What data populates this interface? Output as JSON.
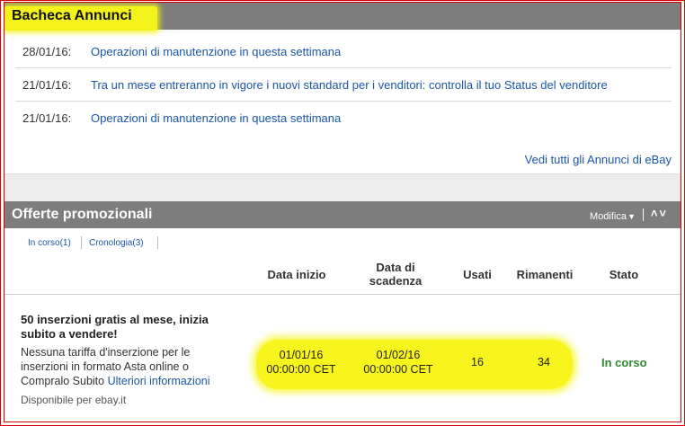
{
  "announcements": {
    "title": "Bacheca Annunci",
    "items": [
      {
        "date": "28/01/16:",
        "text": "Operazioni di manutenzione in questa settimana"
      },
      {
        "date": "21/01/16:",
        "text": "Tra un mese entreranno in vigore i nuovi standard per i venditori: controlla il tuo Status del venditore"
      },
      {
        "date": "21/01/16:",
        "text": "Operazioni di manutenzione in questa settimana"
      }
    ],
    "see_all": "Vedi tutti gli Annunci di eBay"
  },
  "promotions": {
    "title": "Offerte promozionali",
    "modify_label": "Modifica",
    "tabs": [
      {
        "label": "In corso(1)"
      },
      {
        "label": "Cronologia(3)"
      }
    ],
    "columns": {
      "start": "Data inizio",
      "expiry_line1": "Data di",
      "expiry_line2": "scadenza",
      "used": "Usati",
      "remaining": "Rimanenti",
      "status": "Stato"
    },
    "offer": {
      "title": "50 inserzioni gratis al mese, inizia subito a vendere!",
      "description": "Nessuna tariffa d'inserzione per le inserzioni in formato Asta online o Compralo Subito",
      "more_info": "Ulteriori informazioni",
      "availability": "Disponibile per ebay.it",
      "start_date": "01/01/16",
      "start_time": "00:00:00 CET",
      "expiry_date": "01/02/16",
      "expiry_time": "00:00:00 CET",
      "used": "16",
      "remaining": "34",
      "status": "In corso"
    }
  },
  "colors": {
    "header_bg": "#7d7d7d",
    "link": "#1a56a8",
    "highlight": "#f3f21a",
    "status_green": "#2e8b2e",
    "frame_red": "#e00000"
  }
}
